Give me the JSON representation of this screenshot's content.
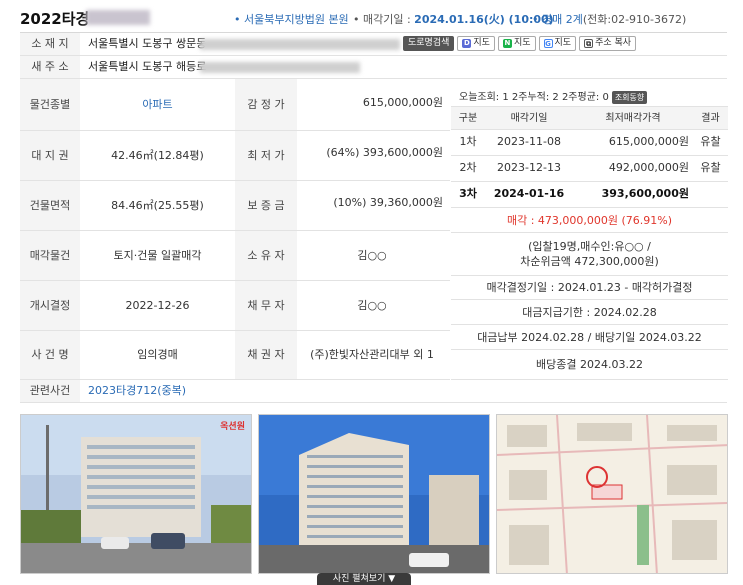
{
  "header": {
    "case_number": "2022타경",
    "court": "• 서울북부지방법원 본원",
    "sale_date_label": "• 매각기일 : ",
    "sale_date_value": "2024.01.16(火) (10:00)",
    "dept_label": "• 경매 2계",
    "phone": "(전화:02-910-3672)"
  },
  "address": {
    "location_label": "소 재 지",
    "location_value": "서울특별시 도봉구 쌍문동",
    "new_address_label": "새 주 소",
    "new_address_value": "서울특별시 도봉구 해등로",
    "buttons": [
      {
        "label": "도로명검색",
        "icon": ""
      },
      {
        "label": "지도",
        "icon": "daum-map-icon",
        "color": "#5b6bd6"
      },
      {
        "label": "지도",
        "icon": "naver-map-icon",
        "color": "#19b34a"
      },
      {
        "label": "지도",
        "icon": "google-map-icon",
        "color": "#4285f4"
      },
      {
        "label": "주소 복사",
        "icon": "copy-icon"
      }
    ]
  },
  "details": {
    "rows": [
      {
        "label": "물건종별",
        "value": "아파트",
        "label2": "감 정 가",
        "value2": "615,000,000원"
      },
      {
        "label": "대 지 권",
        "value": "42.46㎡(12.84평)",
        "label2": "최 저 가",
        "value2": "(64%) 393,600,000원"
      },
      {
        "label": "건물면적",
        "value": "84.46㎡(25.55평)",
        "label2": "보 증 금",
        "value2": "(10%) 39,360,000원"
      },
      {
        "label": "매각물건",
        "value": "토지·건물 일괄매각",
        "label2": "소 유 자",
        "value2": "김○○"
      },
      {
        "label": "개시결정",
        "value": "2022-12-26",
        "label2": "채 무 자",
        "value2": "김○○"
      },
      {
        "label": "사 건 명",
        "value": "임의경매",
        "label2": "채 권 자",
        "value2": "(주)한빛자산관리대부 외 1"
      }
    ],
    "related_label": "관련사건",
    "related_value": "2023타경712(중복)"
  },
  "bid_panel": {
    "views_text": "오늘조회: 1  2주누적: 2  2주평균: 0",
    "views_button": "조회동향",
    "headers": [
      "구분",
      "매각기일",
      "최저매각가격",
      "결과"
    ],
    "rows": [
      {
        "round": "1차",
        "date": "2023-11-08",
        "price": "615,000,000원",
        "result": "유찰"
      },
      {
        "round": "2차",
        "date": "2023-12-13",
        "price": "492,000,000원",
        "result": "유찰"
      },
      {
        "round": "3차",
        "date": "2024-01-16",
        "price": "393,600,000원",
        "result": ""
      }
    ],
    "sold_text": "매각 : 473,000,000원  (76.91%)",
    "bidders_line1": "(입찰19명,매수인:유○○ /",
    "bidders_line2": "차순위금액 472,300,000원)",
    "decision": "매각결정기일 : 2024.01.23 - 매각허가결정",
    "payment_deadline": "대금지급기한 : 2024.02.28",
    "payment_done": "대금납부 2024.02.28 / 배당기일 2024.03.22",
    "dividend_done": "배당종결 2024.03.22"
  },
  "photos": {
    "expand_label": "사진 펼쳐보기 ▼",
    "watermark": "옥션원"
  }
}
